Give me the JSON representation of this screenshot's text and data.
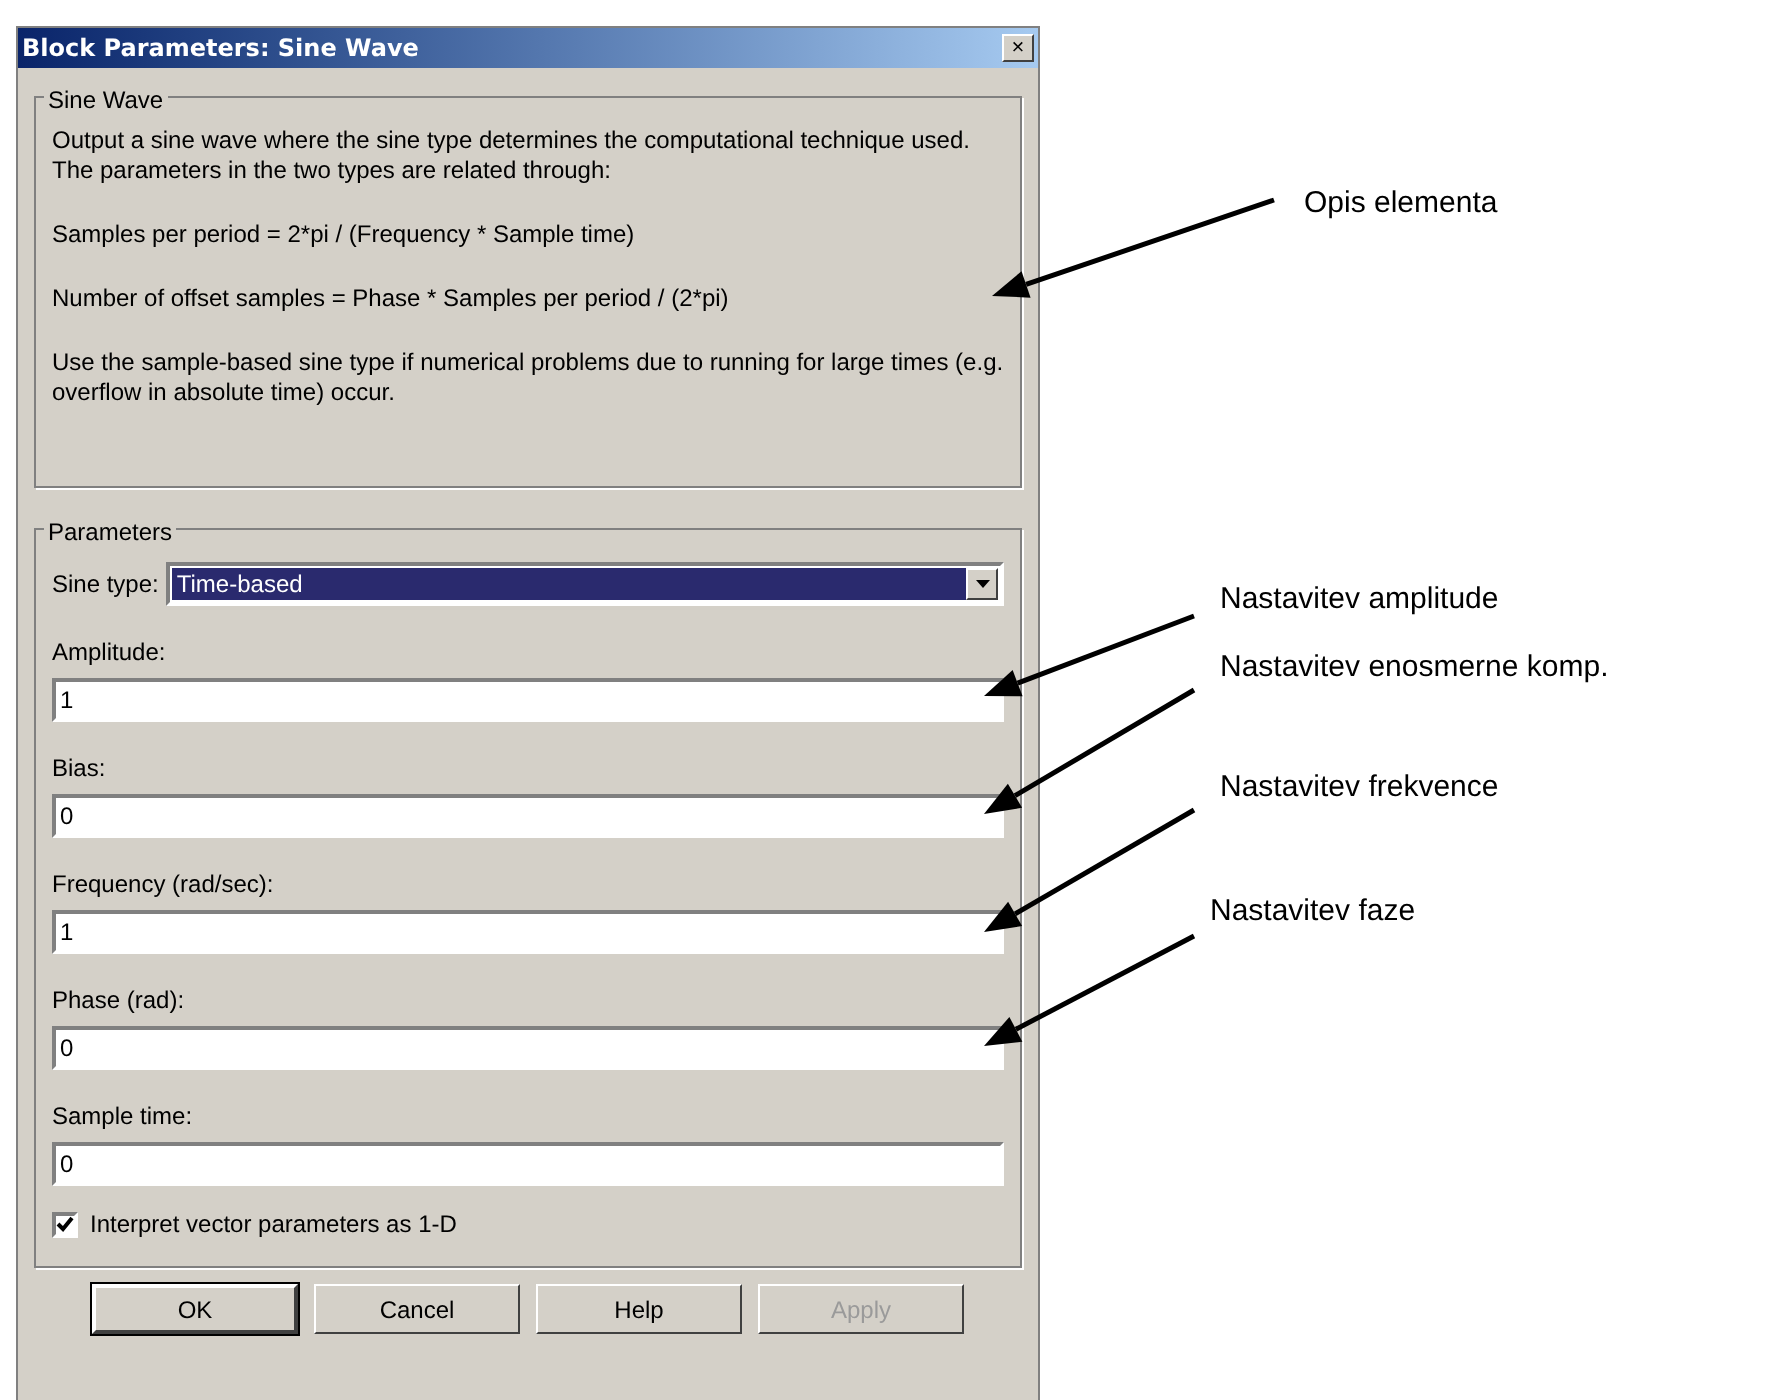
{
  "window": {
    "title": "Block Parameters: Sine Wave",
    "close": "×"
  },
  "description_group": {
    "title": "Sine Wave",
    "paragraphs": [
      "Output a sine wave where the sine type determines the computational technique used. The parameters in the two types are related through:",
      "Samples per period = 2*pi / (Frequency * Sample time)",
      "Number of offset samples = Phase * Samples per period / (2*pi)",
      "Use the sample-based sine type if numerical problems due to running for large times (e.g. overflow in absolute time) occur."
    ]
  },
  "parameters_group": {
    "title": "Parameters",
    "sine_type": {
      "label": "Sine type:",
      "value": "Time-based",
      "selected": true
    },
    "fields": [
      {
        "label": "Amplitude:",
        "value": "1"
      },
      {
        "label": "Bias:",
        "value": "0"
      },
      {
        "label": "Frequency (rad/sec):",
        "value": "1"
      },
      {
        "label": "Phase (rad):",
        "value": "0"
      },
      {
        "label": "Sample time:",
        "value": "0"
      }
    ],
    "checkbox": {
      "label": "Interpret vector parameters as 1-D",
      "checked": true
    }
  },
  "buttons": [
    {
      "label": "OK",
      "disabled": false,
      "default": true
    },
    {
      "label": "Cancel",
      "disabled": false,
      "default": false
    },
    {
      "label": "Help",
      "disabled": false,
      "default": false
    },
    {
      "label": "Apply",
      "disabled": true,
      "default": false
    }
  ],
  "annotations": [
    {
      "text": "Opis elementa"
    },
    {
      "text": "Nastavitev amplitude"
    },
    {
      "text": "Nastavitev enosmerne komp."
    },
    {
      "text": "Nastavitev frekvence"
    },
    {
      "text": "Nastavitev faze"
    }
  ]
}
